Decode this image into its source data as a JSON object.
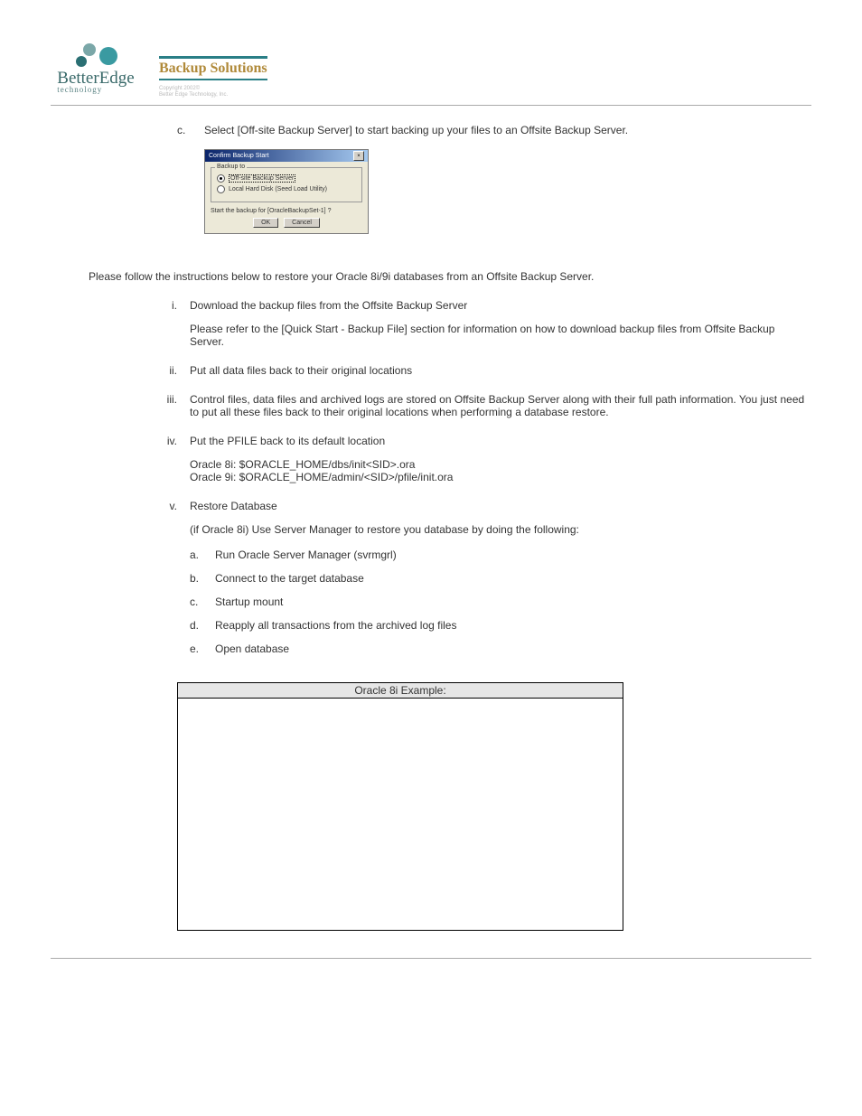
{
  "header": {
    "logo": {
      "line1": "BetterEdge",
      "line2": "technology"
    },
    "title_block": {
      "title": "Backup Solutions",
      "copy1": "Copyright 2002©",
      "copy2": "Better Edge Technology, Inc."
    }
  },
  "step_c": {
    "label": "c.",
    "text": "Select [Off-site Backup Server] to start backing up your files to an Offsite Backup Server."
  },
  "dialog": {
    "title": "Confirm Backup Start",
    "group_title": "Backup to",
    "opt1": "Off-site Backup Server",
    "opt2": "Local Hard Disk (Seed Load Utility)",
    "confirm": "Start the backup for [OracleBackupSet-1] ?",
    "ok": "OK",
    "cancel": "Cancel"
  },
  "intro": "Please follow the instructions below to restore your Oracle 8i/9i databases from an Offsite Backup Server.",
  "steps": {
    "i": {
      "num": "i.",
      "title": "Download the backup files from the Offsite Backup Server",
      "sub": "Please refer to the [Quick Start - Backup File] section for information on how to download backup files from Offsite Backup Server."
    },
    "ii": {
      "num": "ii.",
      "title": "Put all data files back to their original locations"
    },
    "iii": {
      "num": "iii.",
      "title": "Control files, data files and archived logs are stored on Offsite Backup Server along with their full path information. You just need to put all these files back to their original locations when performing a database restore."
    },
    "iv": {
      "num": "iv.",
      "title": "Put the PFILE back to its default location",
      "l1": "Oracle 8i: $ORACLE_HOME/dbs/init<SID>.ora",
      "l2": "Oracle 9i: $ORACLE_HOME/admin/<SID>/pfile/init.ora"
    },
    "v": {
      "num": "v.",
      "title": "Restore Database",
      "sub": "(if Oracle 8i) Use Server Manager to restore you database by doing the following:",
      "a": {
        "n": "a.",
        "t": "Run Oracle Server Manager (svrmgrl)"
      },
      "b": {
        "n": "b.",
        "t": "Connect to the target database"
      },
      "c": {
        "n": "c.",
        "t": "Startup mount"
      },
      "d": {
        "n": "d.",
        "t": "Reapply all transactions from the archived log files"
      },
      "e": {
        "n": "e.",
        "t": "Open database"
      }
    }
  },
  "example": {
    "header": "Oracle 8i Example:"
  }
}
